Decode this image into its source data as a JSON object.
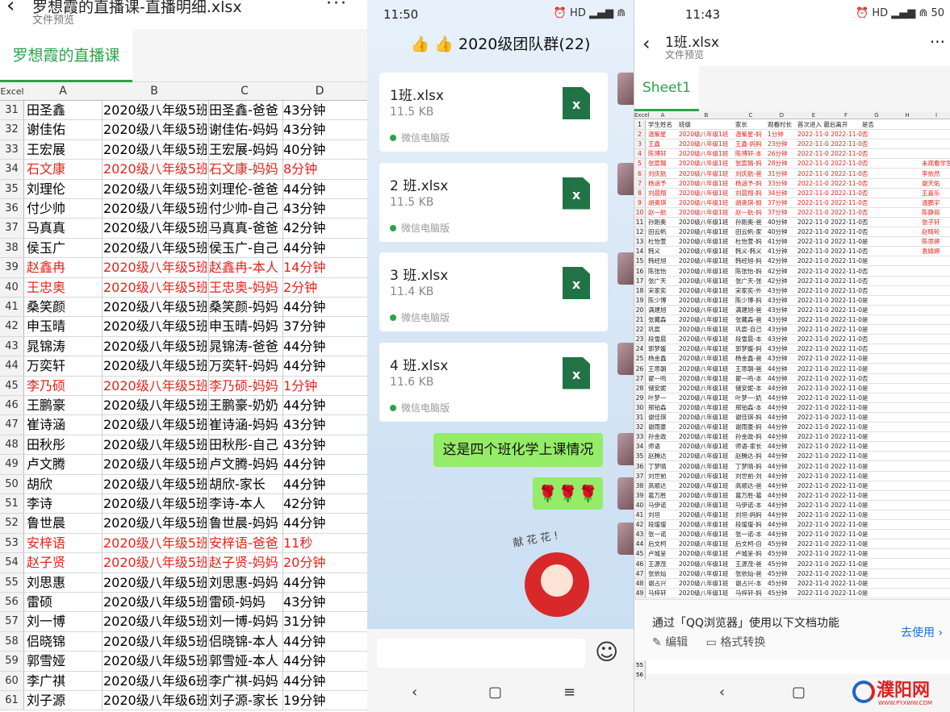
{
  "left": {
    "back_icon": "‹",
    "file_title": "罗想霞的直播课-直播明细.xlsx",
    "file_sub": "文件预览",
    "more": "···",
    "tab": "罗想霞的直播课",
    "col_header": {
      "corner": "Excel",
      "a": "A",
      "b": "B",
      "c": "C",
      "d": "D"
    },
    "rows": [
      {
        "n": "31",
        "a": "田圣鑫",
        "b": "2020级八年级5班",
        "c": "田圣鑫-爸爸",
        "d": "43分钟",
        "red": false
      },
      {
        "n": "32",
        "a": "谢佳佑",
        "b": "2020级八年级5班",
        "c": "谢佳佑-妈妈",
        "d": "43分钟",
        "red": false
      },
      {
        "n": "33",
        "a": "王宏展",
        "b": "2020级八年级5班",
        "c": "王宏展-妈妈",
        "d": "40分钟",
        "red": false
      },
      {
        "n": "34",
        "a": "石文康",
        "b": "2020级八年级5班",
        "c": "石文康-妈妈",
        "d": "8分钟",
        "red": true
      },
      {
        "n": "35",
        "a": "刘理伦",
        "b": "2020级八年级5班",
        "c": "刘理伦-爸爸",
        "d": "44分钟",
        "red": false
      },
      {
        "n": "36",
        "a": "付少帅",
        "b": "2020级八年级5班",
        "c": "付少帅-自己",
        "d": "43分钟",
        "red": false
      },
      {
        "n": "37",
        "a": "马真真",
        "b": "2020级八年级5班",
        "c": "马真真-爸爸",
        "d": "42分钟",
        "red": false
      },
      {
        "n": "38",
        "a": "侯玉广",
        "b": "2020级八年级5班",
        "c": "侯玉广-自己",
        "d": "44分钟",
        "red": false
      },
      {
        "n": "39",
        "a": "赵鑫冉",
        "b": "2020级八年级5班",
        "c": "赵鑫冉-本人",
        "d": "14分钟",
        "red": true
      },
      {
        "n": "40",
        "a": "王忠奥",
        "b": "2020级八年级5班",
        "c": "王忠奥-妈妈",
        "d": "2分钟",
        "red": true
      },
      {
        "n": "41",
        "a": "桑笑颜",
        "b": "2020级八年级5班",
        "c": "桑笑颜-妈妈",
        "d": "44分钟",
        "red": false
      },
      {
        "n": "42",
        "a": "申玉晴",
        "b": "2020级八年级5班",
        "c": "申玉晴-妈妈",
        "d": "37分钟",
        "red": false
      },
      {
        "n": "43",
        "a": "晁锦涛",
        "b": "2020级八年级5班",
        "c": "晁锦涛-爸爸",
        "d": "44分钟",
        "red": false
      },
      {
        "n": "44",
        "a": "万奕轩",
        "b": "2020级八年级5班",
        "c": "万奕轩-妈妈",
        "d": "44分钟",
        "red": false
      },
      {
        "n": "45",
        "a": "李乃硕",
        "b": "2020级八年级5班",
        "c": "李乃硕-妈妈",
        "d": "1分钟",
        "red": true
      },
      {
        "n": "46",
        "a": "王鹏豪",
        "b": "2020级八年级5班",
        "c": "王鹏豪-奶奶",
        "d": "44分钟",
        "red": false
      },
      {
        "n": "47",
        "a": "崔诗涵",
        "b": "2020级八年级5班",
        "c": "崔诗涵-妈妈",
        "d": "43分钟",
        "red": false
      },
      {
        "n": "48",
        "a": "田秋彤",
        "b": "2020级八年级5班",
        "c": "田秋彤-自己",
        "d": "43分钟",
        "red": false
      },
      {
        "n": "49",
        "a": "卢文腾",
        "b": "2020级八年级5班",
        "c": "卢文腾-妈妈",
        "d": "44分钟",
        "red": false
      },
      {
        "n": "50",
        "a": "胡欣",
        "b": "2020级八年级5班",
        "c": "胡欣-家长",
        "d": "44分钟",
        "red": false
      },
      {
        "n": "51",
        "a": "李诗",
        "b": "2020级八年级5班",
        "c": "李诗-本人",
        "d": "42分钟",
        "red": false
      },
      {
        "n": "52",
        "a": "鲁世晨",
        "b": "2020级八年级5班",
        "c": "鲁世晨-妈妈",
        "d": "44分钟",
        "red": false
      },
      {
        "n": "53",
        "a": "安梓语",
        "b": "2020级八年级5班",
        "c": "安梓语-爸爸",
        "d": "11秒",
        "red": true
      },
      {
        "n": "54",
        "a": "赵子贤",
        "b": "2020级八年级5班",
        "c": "赵子贤-妈妈",
        "d": "20分钟",
        "red": true
      },
      {
        "n": "55",
        "a": "刘思惠",
        "b": "2020级八年级5班",
        "c": "刘思惠-妈妈",
        "d": "44分钟",
        "red": false
      },
      {
        "n": "56",
        "a": "雷硕",
        "b": "2020级八年级5班",
        "c": "雷硕-妈妈",
        "d": "43分钟",
        "red": false
      },
      {
        "n": "57",
        "a": "刘一博",
        "b": "2020级八年级5班",
        "c": "刘一博-妈妈",
        "d": "31分钟",
        "red": false
      },
      {
        "n": "58",
        "a": "侣晓锦",
        "b": "2020级八年级5班",
        "c": "侣晓锦-本人",
        "d": "44分钟",
        "red": false
      },
      {
        "n": "59",
        "a": "郭雪娅",
        "b": "2020级八年级5班",
        "c": "郭雪娅-本人",
        "d": "44分钟",
        "red": false
      },
      {
        "n": "60",
        "a": "李广祺",
        "b": "2020级八年级6班",
        "c": "李广祺-妈妈",
        "d": "44分钟",
        "red": false
      },
      {
        "n": "61",
        "a": "刘子源",
        "b": "2020级八年级6班",
        "c": "刘子源-家长",
        "d": "19分钟",
        "red": false
      }
    ]
  },
  "middle": {
    "time": "11:50",
    "status_icons": "⏰ HD ▂▄▆ ⋒",
    "group_title": "👍 👍 2020级团队群(22)",
    "files": [
      {
        "name": "1班.xlsx",
        "size": "11.5 KB",
        "source": "微信电脑版"
      },
      {
        "name": "2 班.xlsx",
        "size": "11.5 KB",
        "source": "微信电脑版"
      },
      {
        "name": "3 班.xlsx",
        "size": "11.4 KB",
        "source": "微信电脑版"
      },
      {
        "name": "4 班.xlsx",
        "size": "11.6 KB",
        "source": "微信电脑版"
      }
    ],
    "xls_icon": "x",
    "message": "这是四个班化学上课情况",
    "roses": "🌹🌹🌹",
    "sticker_text": "献 花 花 !",
    "emoji_icon": "☺",
    "nav": {
      "back": "‹",
      "home": "▢",
      "menu": "≡"
    }
  },
  "right": {
    "time": "11:43",
    "status_icons": "⏰ HD ▂▄▆ ⋒ 50",
    "back_icon": "‹",
    "file_title": "1班.xlsx",
    "file_sub": "文件预览",
    "more": "···",
    "tab": "Sheet1",
    "col_header": [
      "Excel",
      "A",
      "B",
      "C",
      "D",
      "E",
      "F",
      "G",
      "H",
      "I"
    ],
    "header_row": {
      "n": "1",
      "a": "学生姓名",
      "b": "班级",
      "c": "家长",
      "d": "观看时长",
      "e": "首次进入 最后离开",
      "g": "是否评论",
      "i": ""
    },
    "rows": [
      {
        "n": "2",
        "a": "温紫星",
        "b": "2020级八年级1班",
        "c": "温紫星-妈",
        "d": "1分钟",
        "e": "2022-11-0 2022-11-0",
        "g": "否",
        "i": "",
        "red": true
      },
      {
        "n": "3",
        "a": "王鑫",
        "b": "2020级八年级1班",
        "c": "王鑫-妈妈",
        "d": "23分钟",
        "e": "2022-11-0 2022-11-0",
        "g": "否",
        "i": "",
        "red": true
      },
      {
        "n": "4",
        "a": "陈博轩",
        "b": "2020级八年级1班",
        "c": "陈博轩-本",
        "d": "26分钟",
        "e": "2022-11-0 2022-11-0",
        "g": "否",
        "i": "",
        "red": true
      },
      {
        "n": "5",
        "a": "张宸璐",
        "b": "2020级八年级1班",
        "c": "张宸璐-妈",
        "d": "28分钟",
        "e": "2022-11-0 2022-11-0",
        "g": "否",
        "i": "未观看学生",
        "red": true
      },
      {
        "n": "6",
        "a": "刘庆航",
        "b": "2020级八年级1班",
        "c": "刘庆航-爸",
        "d": "31分钟",
        "e": "2022-11-0 2022-11-0",
        "g": "否",
        "i": "李依然",
        "red": true
      },
      {
        "n": "7",
        "a": "杨涵予",
        "b": "2020级八年级1班",
        "c": "杨涵予-妈",
        "d": "33分钟",
        "e": "2022-11-0 2022-11-0",
        "g": "否",
        "i": "谢天佑",
        "red": true
      },
      {
        "n": "8",
        "a": "刘晨翔",
        "b": "2020级八年级1班",
        "c": "刘晨翔-妈",
        "d": "34分钟",
        "e": "2022-11-0 2022-11-0",
        "g": "否",
        "i": "王嘉乐",
        "red": true
      },
      {
        "n": "9",
        "a": "胡奥琪",
        "b": "2020级八年级1班",
        "c": "胡奥琪-姐",
        "d": "37分钟",
        "e": "2022-11-0 2022-11-0",
        "g": "否",
        "i": "温鹏宇",
        "red": true
      },
      {
        "n": "10",
        "a": "赵一航",
        "b": "2020级八年级1班",
        "c": "赵一航-妈",
        "d": "37分钟",
        "e": "2022-11-0 2022-11-0",
        "g": "否",
        "i": "陈静茹",
        "red": true
      },
      {
        "n": "11",
        "a": "孙刚奥",
        "b": "2020级八年级1班",
        "c": "孙刚奥-爸",
        "d": "40分钟",
        "e": "2022-11-0 2022-11-0",
        "g": "否",
        "i": "张子轩",
        "red": false
      },
      {
        "n": "12",
        "a": "田云帆",
        "b": "2020级八年级1班",
        "c": "田云帆-家",
        "d": "40分钟",
        "e": "2022-11-0 2022-11-0",
        "g": "否",
        "i": "赵晴轮",
        "red": false
      },
      {
        "n": "13",
        "a": "杜怡萱",
        "b": "2020级八年级1班",
        "c": "杜怡萱-妈",
        "d": "41分钟",
        "e": "2022-11-0 2022-11-0",
        "g": "是",
        "i": "陈思婷",
        "red": false
      },
      {
        "n": "14",
        "a": "韩义",
        "b": "2020级八年级1班",
        "c": "韩义-韩义",
        "d": "41分钟",
        "e": "2022-11-0 2022-11-0",
        "g": "否",
        "i": "袁婧婷",
        "red": false
      },
      {
        "n": "15",
        "a": "韩经旭",
        "b": "2020级八年级1班",
        "c": "韩经旭-妈",
        "d": "42分钟",
        "e": "2022-11-0 2022-11-0",
        "g": "是",
        "i": "",
        "red": false
      },
      {
        "n": "16",
        "a": "陈张怡",
        "b": "2020级八年级1班",
        "c": "陈张怡-妈",
        "d": "42分钟",
        "e": "2022-11-0 2022-11-0",
        "g": "否",
        "i": "",
        "red": false
      },
      {
        "n": "17",
        "a": "张广天",
        "b": "2020级八年级1班",
        "c": "张广天-张",
        "d": "42分钟",
        "e": "2022-11-0 2022-11-0",
        "g": "否",
        "i": "",
        "red": false
      },
      {
        "n": "18",
        "a": "宋家奕",
        "b": "2020级八年级1班",
        "c": "宋家奕-外",
        "d": "43分钟",
        "e": "2022-11-0 2022-11-0",
        "g": "否",
        "i": "",
        "red": false
      },
      {
        "n": "19",
        "a": "陈少博",
        "b": "2020级八年级1班",
        "c": "陈少博-妈",
        "d": "43分钟",
        "e": "2022-11-0 2022-11-0",
        "g": "是",
        "i": "",
        "red": false
      },
      {
        "n": "20",
        "a": "满建旭",
        "b": "2020级八年级1班",
        "c": "满建旭-爸",
        "d": "43分钟",
        "e": "2022-11-0 2022-11-0",
        "g": "是",
        "i": "",
        "red": false
      },
      {
        "n": "21",
        "a": "张藏森",
        "b": "2020级八年级1班",
        "c": "张藏森-爸",
        "d": "43分钟",
        "e": "2022-11-0 2022-11-0",
        "g": "是",
        "i": "",
        "red": false
      },
      {
        "n": "22",
        "a": "巩宸",
        "b": "2020级八年级1班",
        "c": "巩宸-自己",
        "d": "43分钟",
        "e": "2022-11-0 2022-11-0",
        "g": "是",
        "i": "",
        "red": false
      },
      {
        "n": "23",
        "a": "段雪晨",
        "b": "2020级八年级1班",
        "c": "段雪晨-本",
        "d": "43分钟",
        "e": "2022-11-0 2022-11-0",
        "g": "否",
        "i": "",
        "red": false
      },
      {
        "n": "24",
        "a": "郭梦媛",
        "b": "2020级八年级1班",
        "c": "郭梦媛-妈",
        "d": "43分钟",
        "e": "2022-11-0 2022-11-0",
        "g": "否",
        "i": "",
        "red": false
      },
      {
        "n": "25",
        "a": "杨金鑫",
        "b": "2020级八年级1班",
        "c": "杨金鑫-爸",
        "d": "43分钟",
        "e": "2022-11-0 2022-11-0",
        "g": "是",
        "i": "",
        "red": false
      },
      {
        "n": "26",
        "a": "王思朝",
        "b": "2020级八年级1班",
        "c": "王思朝-爸",
        "d": "44分钟",
        "e": "2022-11-0 2022-11-0",
        "g": "是",
        "i": "",
        "red": false
      },
      {
        "n": "27",
        "a": "翟一鸣",
        "b": "2020级八年级1班",
        "c": "翟一鸣-本",
        "d": "44分钟",
        "e": "2022-11-0 2022-11-0",
        "g": "否",
        "i": "",
        "red": false
      },
      {
        "n": "28",
        "a": "储安妮",
        "b": "2020级八年级1班",
        "c": "储安妮-本",
        "d": "44分钟",
        "e": "2022-11-0 2022-11-0",
        "g": "是",
        "i": "",
        "red": false
      },
      {
        "n": "29",
        "a": "叶梦一",
        "b": "2020级八年级1班",
        "c": "叶梦一-奶",
        "d": "44分钟",
        "e": "2022-11-0 2022-11-0",
        "g": "是",
        "i": "",
        "red": false
      },
      {
        "n": "30",
        "a": "邢铂森",
        "b": "2020级八年级1班",
        "c": "邢铂森-本",
        "d": "44分钟",
        "e": "2022-11-0 2022-11-0",
        "g": "是",
        "i": "",
        "red": false
      },
      {
        "n": "31",
        "a": "谢佳琪",
        "b": "2020级八年级1班",
        "c": "谢佳琪-妈",
        "d": "44分钟",
        "e": "2022-11-0 2022-11-0",
        "g": "是",
        "i": "",
        "red": false
      },
      {
        "n": "32",
        "a": "谢雨豪",
        "b": "2020级八年级1班",
        "c": "谢雨豪-妈",
        "d": "44分钟",
        "e": "2022-11-0 2022-11-0",
        "g": "是",
        "i": "",
        "red": false
      },
      {
        "n": "33",
        "a": "孙金政",
        "b": "2020级八年级1班",
        "c": "孙金政-妈",
        "d": "44分钟",
        "e": "2022-11-0 2022-11-0",
        "g": "是",
        "i": "",
        "red": false
      },
      {
        "n": "34",
        "a": "师语",
        "b": "2020级八年级1班",
        "c": "师语-家长",
        "d": "44分钟",
        "e": "2022-11-0 2022-11-0",
        "g": "是",
        "i": "",
        "red": false
      },
      {
        "n": "35",
        "a": "赵腾达",
        "b": "2020级八年级1班",
        "c": "赵腾达-妈",
        "d": "44分钟",
        "e": "2022-11-0 2022-11-0",
        "g": "是",
        "i": "",
        "red": false
      },
      {
        "n": "36",
        "a": "丁梦晴",
        "b": "2020级八年级1班",
        "c": "丁梦晴-妈",
        "d": "44分钟",
        "e": "2022-11-0 2022-11-0",
        "g": "是",
        "i": "",
        "red": false
      },
      {
        "n": "37",
        "a": "刘世前",
        "b": "2020级八年级1班",
        "c": "刘世前-刘",
        "d": "44分钟",
        "e": "2022-11-0 2022-11-0",
        "g": "是",
        "i": "",
        "red": false
      },
      {
        "n": "38",
        "a": "高顺达",
        "b": "2020级八年级1班",
        "c": "高顺达-爸",
        "d": "44分钟",
        "e": "2022-11-0 2022-11-0",
        "g": "是",
        "i": "",
        "red": false
      },
      {
        "n": "39",
        "a": "葛万胜",
        "b": "2020级八年级1班",
        "c": "葛万胜-葛",
        "d": "44分钟",
        "e": "2022-11-0 2022-11-0",
        "g": "是",
        "i": "",
        "red": false
      },
      {
        "n": "40",
        "a": "马伊诺",
        "b": "2020级八年级1班",
        "c": "马伊诺-本",
        "d": "44分钟",
        "e": "2022-11-0 2022-11-0",
        "g": "是",
        "i": "",
        "red": false
      },
      {
        "n": "41",
        "a": "刘坦",
        "b": "2020级八年级1班",
        "c": "刘坦-妈妈",
        "d": "44分钟",
        "e": "2022-11-0 2022-11-0",
        "g": "是",
        "i": "",
        "red": false
      },
      {
        "n": "42",
        "a": "段瑷瑷",
        "b": "2020级八年级1班",
        "c": "段瑷瑷-妈",
        "d": "44分钟",
        "e": "2022-11-0 2022-11-0",
        "g": "是",
        "i": "",
        "red": false
      },
      {
        "n": "43",
        "a": "张一诺",
        "b": "2020级八年级1班",
        "c": "张一诺-本",
        "d": "44分钟",
        "e": "2022-11-0 2022-11-0",
        "g": "是",
        "i": "",
        "red": false
      },
      {
        "n": "44",
        "a": "后文柯",
        "b": "2020级八年级1班",
        "c": "后文柯-自",
        "d": "45分钟",
        "e": "2022-11-0 2022-11-0",
        "g": "是",
        "i": "",
        "red": false
      },
      {
        "n": "45",
        "a": "卢城呈",
        "b": "2020级八年级1班",
        "c": "卢城呈-妈",
        "d": "45分钟",
        "e": "2022-11-0 2022-11-0",
        "g": "是",
        "i": "",
        "red": false
      },
      {
        "n": "46",
        "a": "王源茂",
        "b": "2020级八年级1班",
        "c": "王源茂-爸",
        "d": "45分钟",
        "e": "2022-11-0 2022-11-0",
        "g": "是",
        "i": "",
        "red": false
      },
      {
        "n": "47",
        "a": "张依灿",
        "b": "2020级八年级1班",
        "c": "张依灿-爸",
        "d": "45分钟",
        "e": "2022-11-0 2022-11-0",
        "g": "是",
        "i": "",
        "red": false
      },
      {
        "n": "48",
        "a": "谢占兴",
        "b": "2020级八年级1班",
        "c": "谢占兴-本",
        "d": "45分钟",
        "e": "2022-11-0 2022-11-0",
        "g": "是",
        "i": "",
        "red": false
      },
      {
        "n": "49",
        "a": "马梓轩",
        "b": "2020级八年级1班",
        "c": "马梓轩-妈",
        "d": "45分钟",
        "e": "2022-11-0 2022-11-0",
        "g": "是",
        "i": "",
        "red": false
      }
    ],
    "promo_text": "通过「QQ浏览器」使用以下文档功能",
    "promo_edit": "编辑",
    "promo_convert": "格式转换",
    "promo_use": "去使用 ›",
    "below_rows": [
      "55",
      "56"
    ],
    "nav": {
      "back": "‹",
      "home": "▢"
    },
    "logo_main": "濮阳网",
    "logo_sub": "WWW.PYXWW.COM"
  }
}
